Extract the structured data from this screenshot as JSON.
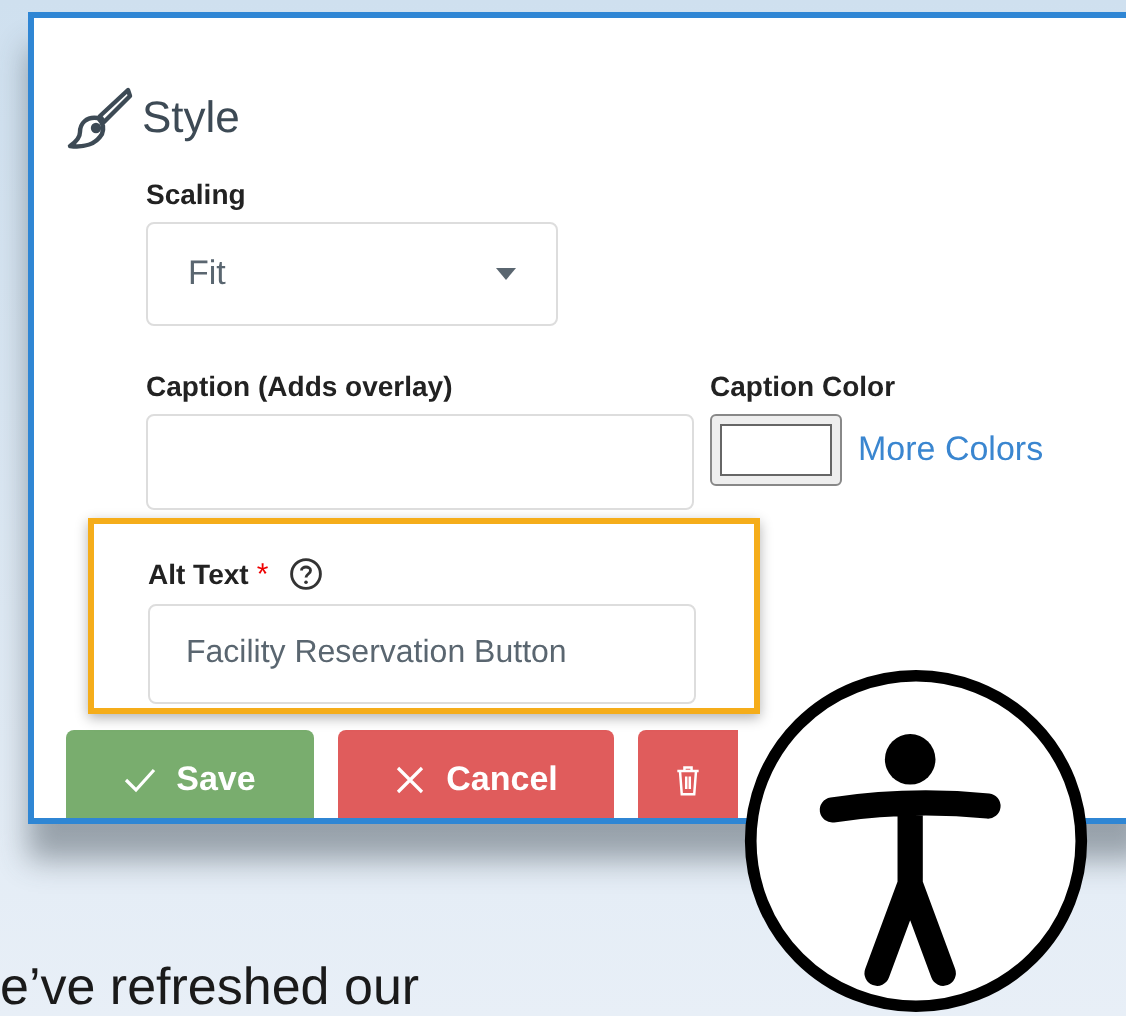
{
  "section_title": "Style",
  "scaling": {
    "label": "Scaling",
    "value": "Fit"
  },
  "caption": {
    "label": "Caption (Adds overlay)"
  },
  "caption_color": {
    "label": "Caption Color",
    "color": "#ffffff",
    "link": "More Colors"
  },
  "alt_text": {
    "label": "Alt Text",
    "required_mark": "*",
    "value": "Facility Reservation Button"
  },
  "buttons": [
    {
      "kind": "save",
      "label": "Save"
    },
    {
      "kind": "cancel",
      "label": "Cancel"
    },
    {
      "kind": "delete"
    }
  ],
  "footer_text": "e’ve refreshed our"
}
